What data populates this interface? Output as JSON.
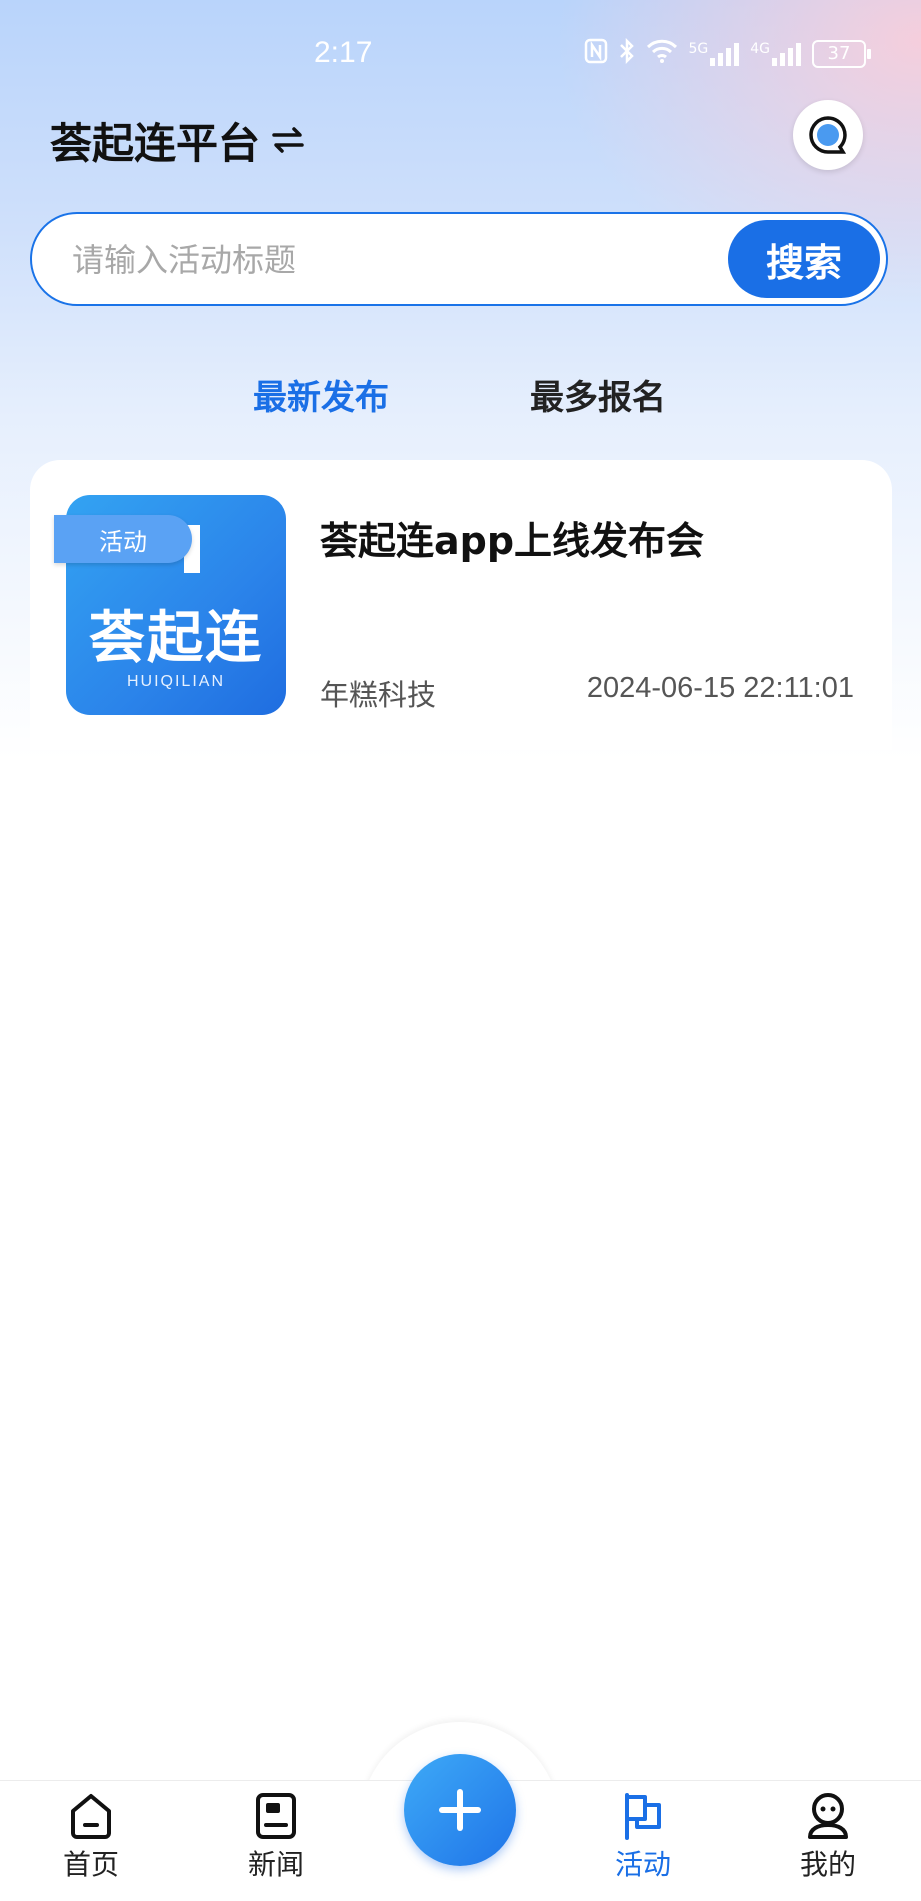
{
  "status_bar": {
    "time": "2:17",
    "signal_5g": "5G",
    "signal_4g": "4G",
    "battery": "37"
  },
  "header": {
    "title": "荟起连平台"
  },
  "search": {
    "placeholder": "请输入活动标题",
    "button_label": "搜索"
  },
  "tabs": [
    {
      "label": "最新发布",
      "active": true
    },
    {
      "label": "最多报名",
      "active": false
    }
  ],
  "activities": [
    {
      "tag": "活动",
      "thumb_brand": "荟起连",
      "thumb_sub": "HUIQILIAN",
      "title": "荟起连app上线发布会",
      "organizer": "年糕科技",
      "date": "2024-06-15 22:11:01"
    }
  ],
  "bottom_nav": {
    "items": [
      {
        "label": "首页",
        "icon": "home-icon"
      },
      {
        "label": "新闻",
        "icon": "news-icon"
      },
      {
        "label": "活动",
        "icon": "flag-icon",
        "active": true
      },
      {
        "label": "我的",
        "icon": "user-icon"
      }
    ],
    "add_icon": "plus-icon"
  },
  "colors": {
    "accent": "#1a6fe6",
    "text_primary": "#111111",
    "text_secondary": "#555555"
  }
}
